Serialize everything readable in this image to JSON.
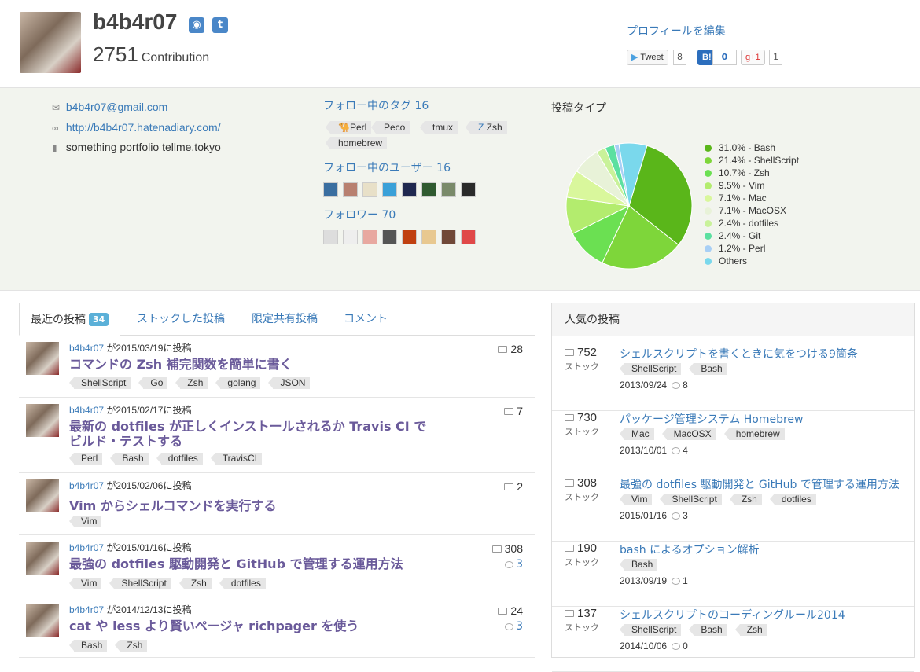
{
  "header": {
    "username": "b4b4r07",
    "contribution_count": "2751",
    "contribution_label": "Contribution",
    "edit_profile": "プロフィールを編集",
    "tweet_label": "Tweet",
    "tweet_count": "8",
    "hatena_label": "B!",
    "hatena_count": "0",
    "gplus_label": "g+1",
    "gplus_count": "1"
  },
  "profile": {
    "email": "b4b4r07@gmail.com",
    "website": "http://b4b4r07.hatenadiary.com/",
    "description": "something portfolio tellme.tokyo",
    "following_tags_label": "フォロー中のタグ 16",
    "following_tags": [
      "Perl",
      "Peco",
      "tmux",
      "Zsh",
      "homebrew"
    ],
    "following_users_label": "フォロー中のユーザー 16",
    "followers_label": "フォロワー 70",
    "post_types_label": "投稿タイプ"
  },
  "chart_data": {
    "type": "pie",
    "title": "投稿タイプ",
    "slices": [
      {
        "label": "31.0% - Bash",
        "value": 31.0,
        "color": "#5ab61a"
      },
      {
        "label": "21.4% - ShellScript",
        "value": 21.4,
        "color": "#7ed63a"
      },
      {
        "label": "10.7% - Zsh",
        "value": 10.7,
        "color": "#6be052"
      },
      {
        "label": "9.5% - Vim",
        "value": 9.5,
        "color": "#b3ec6e"
      },
      {
        "label": "7.1% - Mac",
        "value": 7.1,
        "color": "#d9f79c"
      },
      {
        "label": "7.1% - MacOSX",
        "value": 7.1,
        "color": "#e8f2d8"
      },
      {
        "label": "2.4% - dotfiles",
        "value": 2.4,
        "color": "#c9f29a"
      },
      {
        "label": "2.4% - Git",
        "value": 2.4,
        "color": "#5ce0a0"
      },
      {
        "label": "1.2% - Perl",
        "value": 1.2,
        "color": "#a8cff5"
      },
      {
        "label": "Others",
        "value": 7.2,
        "color": "#7ad8ec"
      }
    ]
  },
  "tabs": {
    "recent": "最近の投稿",
    "recent_count": "34",
    "stocked": "ストックした投稿",
    "limited": "限定共有投稿",
    "comments": "コメント"
  },
  "posts": [
    {
      "user": "b4b4r07",
      "meta": "が2015/03/19に投稿",
      "title": "コマンドの Zsh 補完関数を簡単に書く",
      "tags": [
        "ShellScript",
        "Go",
        "Zsh",
        "golang",
        "JSON"
      ],
      "stocks": "28",
      "comments": ""
    },
    {
      "user": "b4b4r07",
      "meta": "が2015/02/17に投稿",
      "title": "最新の dotfiles が正しくインストールされるか Travis CI でビルド・テストする",
      "tags": [
        "Perl",
        "Bash",
        "dotfiles",
        "TravisCI"
      ],
      "stocks": "7",
      "comments": ""
    },
    {
      "user": "b4b4r07",
      "meta": "が2015/02/06に投稿",
      "title": "Vim からシェルコマンドを実行する",
      "tags": [
        "Vim"
      ],
      "stocks": "2",
      "comments": ""
    },
    {
      "user": "b4b4r07",
      "meta": "が2015/01/16に投稿",
      "title": "最強の dotfiles 駆動開発と GitHub で管理する運用方法",
      "tags": [
        "Vim",
        "ShellScript",
        "Zsh",
        "dotfiles"
      ],
      "stocks": "308",
      "comments": "3"
    },
    {
      "user": "b4b4r07",
      "meta": "が2014/12/13に投稿",
      "title": "cat や less より賢いページャ richpager を使う",
      "tags": [
        "Bash",
        "Zsh"
      ],
      "stocks": "24",
      "comments": "3"
    }
  ],
  "popular": {
    "heading": "人気の投稿",
    "stock_label": "ストック",
    "items": [
      {
        "count": "752",
        "title": "シェルスクリプトを書くときに気をつける9箇条",
        "tags": [
          "ShellScript",
          "Bash"
        ],
        "date": "2013/09/24",
        "comments": "8"
      },
      {
        "count": "730",
        "title": "パッケージ管理システム Homebrew",
        "tags": [
          "Mac",
          "MacOSX",
          "homebrew"
        ],
        "date": "2013/10/01",
        "comments": "4"
      },
      {
        "count": "308",
        "title": "最強の dotfiles 駆動開発と GitHub で管理する運用方法",
        "tags": [
          "Vim",
          "ShellScript",
          "Zsh",
          "dotfiles"
        ],
        "date": "2015/01/16",
        "comments": "3"
      },
      {
        "count": "190",
        "title": "bash によるオプション解析",
        "tags": [
          "Bash"
        ],
        "date": "2013/09/19",
        "comments": "1"
      },
      {
        "count": "137",
        "title": "シェルスクリプトのコーディングルール2014",
        "tags": [
          "ShellScript",
          "Bash",
          "Zsh"
        ],
        "date": "2014/10/06",
        "comments": "0"
      }
    ]
  }
}
